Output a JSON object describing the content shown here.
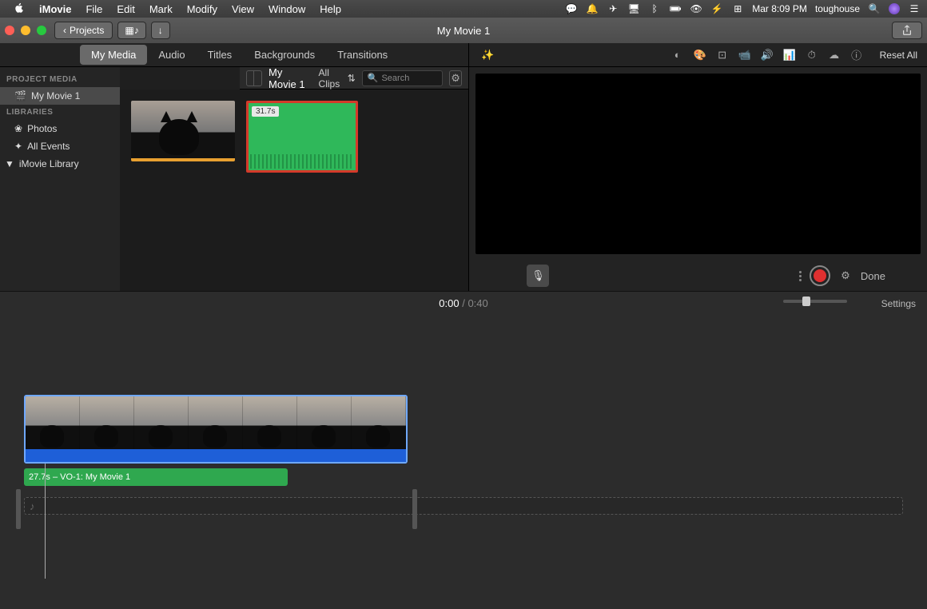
{
  "menubar": {
    "apple": "",
    "app": "iMovie",
    "items": [
      "File",
      "Edit",
      "Mark",
      "Modify",
      "View",
      "Window",
      "Help"
    ],
    "status_icons": [
      "wechat",
      "notifications",
      "location",
      "display",
      "bluetooth",
      "battery",
      "eye",
      "power",
      "keyboard-viewer"
    ],
    "datetime": "Mar 8:09 PM",
    "user": "toughouse"
  },
  "toolbar": {
    "back_label": "Projects",
    "title": "My Movie 1"
  },
  "tabs": {
    "items": [
      "My Media",
      "Audio",
      "Titles",
      "Backgrounds",
      "Transitions"
    ],
    "active": "My Media"
  },
  "browser_header": {
    "project_name": "My Movie 1",
    "filter": "All Clips",
    "search_placeholder": "Search"
  },
  "sidebar": {
    "head1": "PROJECT MEDIA",
    "project": "My Movie 1",
    "head2": "LIBRARIES",
    "photos": "Photos",
    "allevents": "All Events",
    "library": "iMovie Library"
  },
  "clips": {
    "audio_duration": "31.7s"
  },
  "adjust": {
    "reset": "Reset All"
  },
  "recorder": {
    "done": "Done"
  },
  "timecode": {
    "current": "0:00",
    "sep": "/",
    "duration": "0:40",
    "settings": "Settings"
  },
  "voiceover": {
    "label": "27.7s – VO-1: My Movie 1"
  }
}
